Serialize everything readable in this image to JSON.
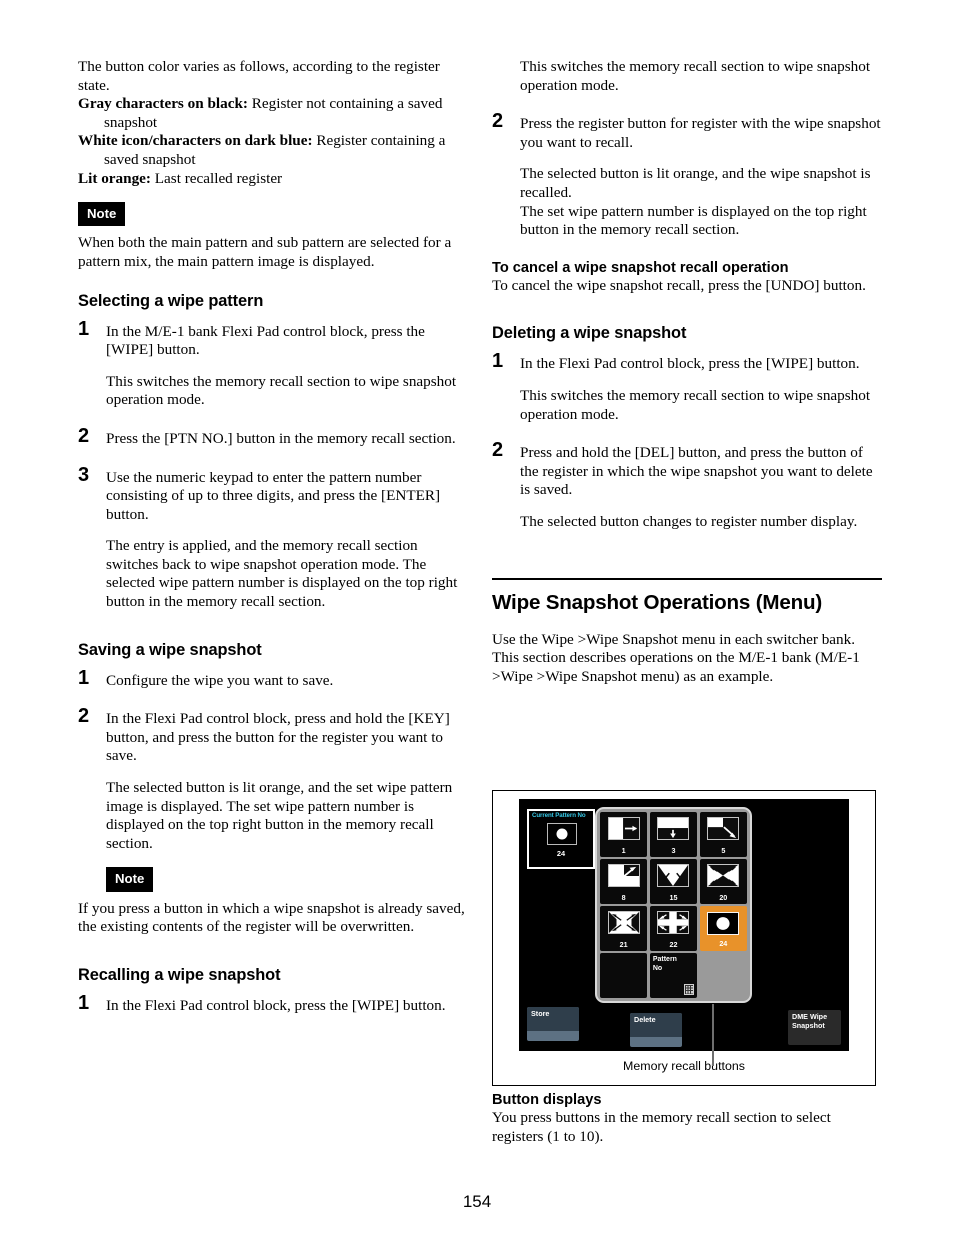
{
  "page": {
    "number": "154"
  },
  "left_column": {
    "intro": {
      "lead": "The button color varies as follows, according to the register state.",
      "defs": [
        {
          "term": "Gray characters on black:",
          "desc": " Register not containing a saved snapshot"
        },
        {
          "term": "White icon/characters on dark blue:",
          "desc": " Register containing a saved snapshot"
        },
        {
          "term": "Lit orange:",
          "desc": " Last recalled register"
        }
      ]
    },
    "note1": {
      "badge": "Note",
      "text": "When both the main pattern and sub pattern are selected for a pattern mix, the main pattern image is displayed."
    },
    "section_selecting": {
      "heading": "Selecting a wipe pattern",
      "steps": [
        {
          "num": "1",
          "body": "In the M/E-1 bank Flexi Pad control block, press the [WIPE] button.",
          "extra": "This switches the memory recall section to wipe snapshot operation mode."
        },
        {
          "num": "2",
          "body": "Press the [PTN NO.] button in the memory recall section.",
          "extra": ""
        },
        {
          "num": "3",
          "body": "Use the numeric keypad to enter the pattern number consisting of up to three digits, and press the [ENTER] button.",
          "extra": "The entry is applied, and the memory recall section switches back to wipe snapshot operation mode. The selected wipe pattern number is displayed on the top right button in the memory recall section."
        }
      ]
    },
    "section_saving": {
      "heading": "Saving a wipe snapshot",
      "steps": [
        {
          "num": "1",
          "body": "Configure the wipe you want to save.",
          "extra": ""
        },
        {
          "num": "2",
          "body": "In the Flexi Pad control block, press and hold the [KEY] button, and press the button for the register you want to save.",
          "extra": "The selected button is lit orange, and the set wipe pattern image is displayed. The set wipe pattern number is displayed on the top right button in the memory recall section."
        }
      ],
      "note": {
        "badge": "Note",
        "text": "If you press a button in which a wipe snapshot is already saved, the existing contents of the register will be overwritten."
      }
    },
    "section_recalling": {
      "heading": "Recalling a wipe snapshot",
      "steps": [
        {
          "num": "1",
          "body": "In the Flexi Pad control block, press the [WIPE] button.",
          "extra": ""
        }
      ]
    }
  },
  "right_column": {
    "continued": {
      "step1_extra": "This switches the memory recall section to wipe snapshot operation mode.",
      "step2": {
        "num": "2",
        "body": "Press the register button for register with the wipe snapshot you want to recall.",
        "extra_a": "The selected button is lit orange, and the wipe snapshot is recalled.",
        "extra_b": "The set wipe pattern number is displayed on the top right button in the memory recall section."
      },
      "cancel": {
        "heading": "To cancel a wipe snapshot recall operation",
        "text": "To cancel the wipe snapshot recall, press the [UNDO] button."
      }
    },
    "section_deleting": {
      "heading": "Deleting a wipe snapshot",
      "steps": [
        {
          "num": "1",
          "body": "In the Flexi Pad control block, press the [WIPE] button.",
          "extra": "This switches the memory recall section to wipe snapshot operation mode."
        },
        {
          "num": "2",
          "body": "Press and hold the [DEL] button, and press the button of the register in which the wipe snapshot you want to delete is saved.",
          "extra": "The selected button changes to register number display."
        }
      ]
    },
    "section_menu": {
      "title": "Wipe Snapshot Operations (Menu)",
      "para1": "Use the Wipe >Wipe Snapshot menu in each switcher bank.",
      "para2": "This section describes operations on the M/E-1 bank (M/E-1 >Wipe >Wipe Snapshot menu) as an example."
    },
    "after_figure": {
      "heading": "Button displays",
      "text": "You press buttons in the memory recall section to select registers (1 to 10)."
    }
  },
  "figure": {
    "current_pattern": {
      "label": "Current Pattern No",
      "number": "24",
      "icon": "circle-wipe-icon",
      "label_color": "#36c8e6"
    },
    "recall_buttons": [
      {
        "number": "1",
        "icon": "wipe-horizontal-right-icon",
        "state": "saved"
      },
      {
        "number": "3",
        "icon": "wipe-vertical-down-icon",
        "state": "saved"
      },
      {
        "number": "5",
        "icon": "wipe-corner-diagonal-icon",
        "state": "saved"
      },
      {
        "number": "8",
        "icon": "wipe-corner-up-right-icon",
        "state": "saved"
      },
      {
        "number": "15",
        "icon": "wipe-v-split-icon",
        "state": "saved"
      },
      {
        "number": "20",
        "icon": "wipe-bowtie-icon",
        "state": "saved"
      },
      {
        "number": "21",
        "icon": "wipe-box-expand-icon",
        "state": "saved"
      },
      {
        "number": "22",
        "icon": "wipe-cross-expand-icon",
        "state": "saved"
      },
      {
        "number": "24",
        "icon": "wipe-circle-icon",
        "state": "selected"
      }
    ],
    "empty_button": {
      "number": "",
      "state": "empty"
    },
    "ptn_button": {
      "label_line1": "Pattern",
      "label_line2": "No",
      "icon": "keypad-icon"
    },
    "blank_button": {
      "state": "blank"
    },
    "function_buttons": [
      {
        "name": "store",
        "label": "Store"
      },
      {
        "name": "delete",
        "label": "Delete"
      },
      {
        "name": "dme-wipe-snapshot",
        "label": "DME Wipe\nSnapshot",
        "line1": "DME Wipe",
        "line2": "Snapshot"
      }
    ],
    "callout": "Memory recall buttons",
    "selected_color": "#e8922a"
  }
}
